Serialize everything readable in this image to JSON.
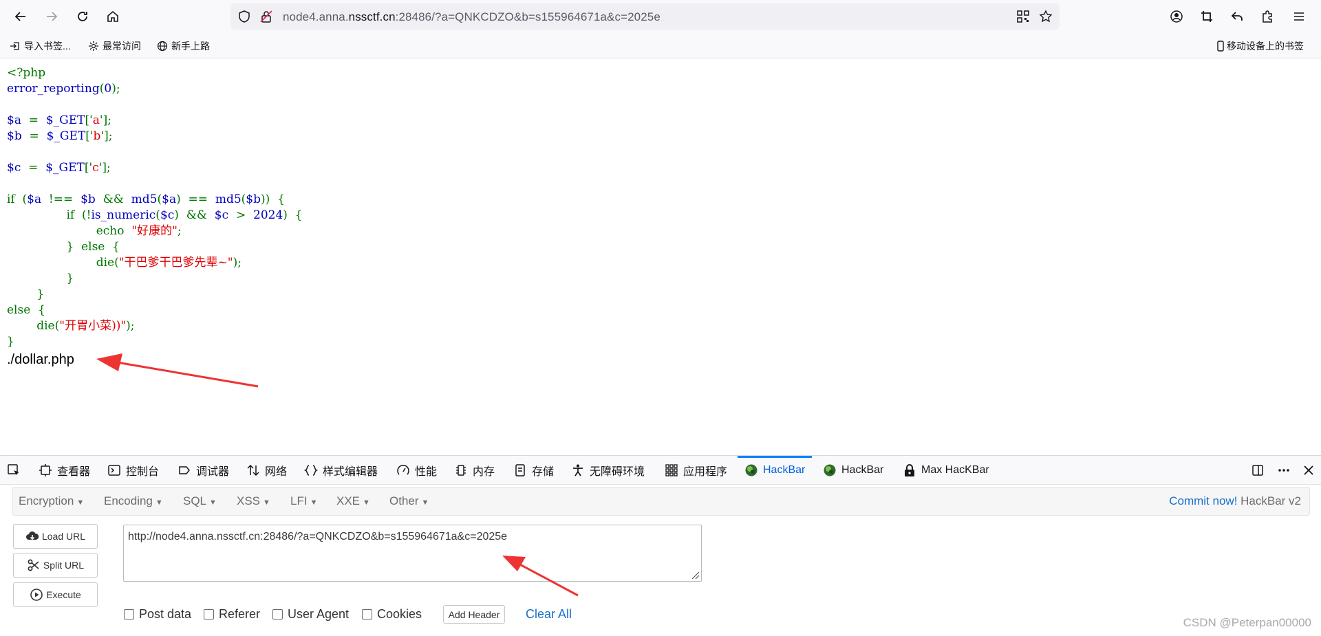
{
  "browser": {
    "url_prefix": "node4.anna.",
    "url_domain": "nssctf.cn",
    "url_suffix": ":28486/?a=QNKCDZO&b=s155964671a&c=2025e",
    "bookmarks": {
      "import": "导入书签...",
      "most_visited": "最常访问",
      "getting_started": "新手上路",
      "mobile": "移动设备上的书签"
    }
  },
  "page": {
    "code_lines": [
      [
        [
          "kw",
          "<?php"
        ]
      ],
      [
        [
          "var",
          "error_reporting"
        ],
        [
          "kw",
          "("
        ],
        [
          "var",
          "0"
        ],
        [
          "kw",
          ");"
        ]
      ],
      [],
      [
        [
          "var",
          "$a"
        ],
        [
          "kw",
          "  =  "
        ],
        [
          "var",
          "$_GET"
        ],
        [
          "kw",
          "['"
        ],
        [
          "str",
          "a"
        ],
        [
          "kw",
          "'];"
        ]
      ],
      [
        [
          "var",
          "$b"
        ],
        [
          "kw",
          "  =  "
        ],
        [
          "var",
          "$_GET"
        ],
        [
          "kw",
          "['"
        ],
        [
          "str",
          "b"
        ],
        [
          "kw",
          "'];"
        ]
      ],
      [],
      [
        [
          "var",
          "$c"
        ],
        [
          "kw",
          "  =  "
        ],
        [
          "var",
          "$_GET"
        ],
        [
          "kw",
          "['"
        ],
        [
          "str",
          "c"
        ],
        [
          "kw",
          "'];"
        ]
      ],
      [],
      [
        [
          "kw",
          "if  ("
        ],
        [
          "var",
          "$a"
        ],
        [
          "kw",
          "  !==  "
        ],
        [
          "var",
          "$b"
        ],
        [
          "kw",
          "  &&  "
        ],
        [
          "var",
          "md5"
        ],
        [
          "kw",
          "("
        ],
        [
          "var",
          "$a"
        ],
        [
          "kw",
          ")  ==  "
        ],
        [
          "var",
          "md5"
        ],
        [
          "kw",
          "("
        ],
        [
          "var",
          "$b"
        ],
        [
          "kw",
          "))  {"
        ]
      ],
      [
        [
          "kw",
          "                if  (!"
        ],
        [
          "var",
          "is_numeric"
        ],
        [
          "kw",
          "("
        ],
        [
          "var",
          "$c"
        ],
        [
          "kw",
          ")  &&  "
        ],
        [
          "var",
          "$c"
        ],
        [
          "kw",
          "  >  "
        ],
        [
          "var",
          "2024"
        ],
        [
          "kw",
          ")  {"
        ]
      ],
      [
        [
          "kw",
          "                        echo  "
        ],
        [
          "str",
          "\"好康的\""
        ],
        [
          "kw",
          ";"
        ]
      ],
      [
        [
          "kw",
          "                }  else  {"
        ]
      ],
      [
        [
          "kw",
          "                        die("
        ],
        [
          "str",
          "\"干巴爹干巴爹先辈~\""
        ],
        [
          "kw",
          ");"
        ]
      ],
      [
        [
          "kw",
          "                }"
        ]
      ],
      [
        [
          "kw",
          "        }"
        ]
      ],
      [
        [
          "kw",
          "else  {"
        ]
      ],
      [
        [
          "kw",
          "        die("
        ],
        [
          "str",
          "\"开胃小菜))\""
        ],
        [
          "kw",
          ");"
        ]
      ],
      [
        [
          "kw",
          "}"
        ]
      ]
    ],
    "output": "./dollar.php"
  },
  "devtools": {
    "tabs": {
      "inspector": "查看器",
      "console": "控制台",
      "debugger": "调试器",
      "network": "网络",
      "style_editor": "样式编辑器",
      "performance": "性能",
      "memory": "内存",
      "storage": "存储",
      "accessibility": "无障碍环境",
      "application": "应用程序",
      "hackbar1": "HackBar",
      "hackbar2": "HackBar",
      "max_hackbar": "Max HacKBar"
    }
  },
  "hackbar": {
    "menu": {
      "encryption": "Encryption",
      "encoding": "Encoding",
      "sql": "SQL",
      "xss": "XSS",
      "lfi": "LFI",
      "xxe": "XXE",
      "other": "Other"
    },
    "commit_link": "Commit now!",
    "version": " HackBar v2",
    "load_url": "Load URL",
    "split_url": "Split URL",
    "execute": "Execute",
    "url_value": "http://node4.anna.nssctf.cn:28486/?a=QNKCDZO&b=s155964671a&c=2025e",
    "options": {
      "post_data": "Post data",
      "referer": "Referer",
      "user_agent": "User Agent",
      "cookies": "Cookies"
    },
    "add_header": "Add Header",
    "clear_all": "Clear All"
  },
  "watermark": "CSDN @Peterpan00000",
  "colors": {
    "accent": "#0a84ff",
    "annotation_arrow": "#ee3333",
    "php_keyword": "#007700",
    "php_var": "#0000bb",
    "php_string": "#dd0000"
  }
}
